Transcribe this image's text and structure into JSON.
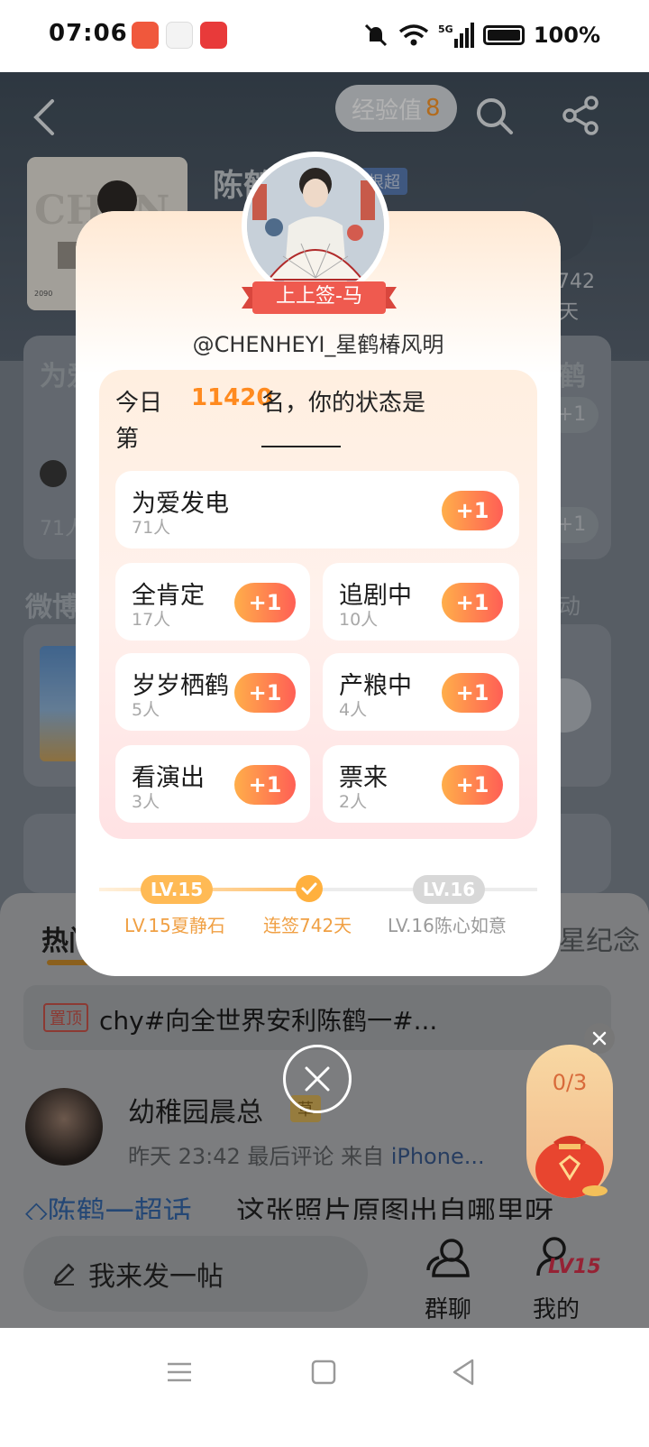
{
  "status_bar": {
    "time": "07:06",
    "battery": "100%"
  },
  "header": {
    "exp_label": "经验值",
    "exp_value": "8",
    "title": "陈鹤",
    "badge": "根超"
  },
  "bg": {
    "checkin_days": "742",
    "checkin_unit": "天",
    "card_title": "为爱",
    "card_right": "鹤",
    "card_count": "71人",
    "weibo": "微博",
    "weibo_right": "动",
    "plus": "+1"
  },
  "feed": {
    "tab_hot": "热门",
    "tab_right": "星纪念",
    "pinned_tag": "置顶",
    "pinned_text": "chy#向全世界安利陈鹤一#...",
    "post_user": "幼稚园晨总",
    "post_vip": "草",
    "post_time": "昨天 23:42 最后评论",
    "post_src_prefix": "来自",
    "post_src": "iPhone...",
    "post_topic": "陈鹤一超话",
    "post_text": "这张照片原图出自哪里呀"
  },
  "bottom": {
    "compose": "我来发一帖",
    "group_chat": "群聊",
    "mine": "我的",
    "level": "LV15"
  },
  "popup": {
    "ribbon": "上上签-马",
    "handle": "@CHENHEYI_星鹤椿风明",
    "rank_prefix_1": "今日",
    "rank_prefix_2": "第",
    "rank_number": "11420",
    "rank_suffix": "名，你的状态是",
    "options": [
      {
        "label": "为爱发电",
        "count": "71人",
        "plus": "+1"
      },
      {
        "label": "全肯定",
        "count": "17人",
        "plus": "+1"
      },
      {
        "label": "追剧中",
        "count": "10人",
        "plus": "+1"
      },
      {
        "label": "岁岁栖鹤",
        "count": "5人",
        "plus": "+1"
      },
      {
        "label": "产粮中",
        "count": "4人",
        "plus": "+1"
      },
      {
        "label": "看演出",
        "count": "3人",
        "plus": "+1"
      },
      {
        "label": "票来",
        "count": "2人",
        "plus": "+1"
      }
    ],
    "level": {
      "current_pill": "LV.15",
      "current_label": "LV.15夏静石",
      "streak_label": "连签742天",
      "next_pill": "LV.16",
      "next_label": "LV.16陈心如意",
      "progress": 0.5
    }
  },
  "lucky_bag": {
    "count": "0/3"
  },
  "colors": {
    "accent": "#ff8a1f",
    "plus_start": "#ffae4a",
    "plus_end": "#ff5f55",
    "ribbon": "#ef5a4f",
    "topic": "#3466a8"
  }
}
